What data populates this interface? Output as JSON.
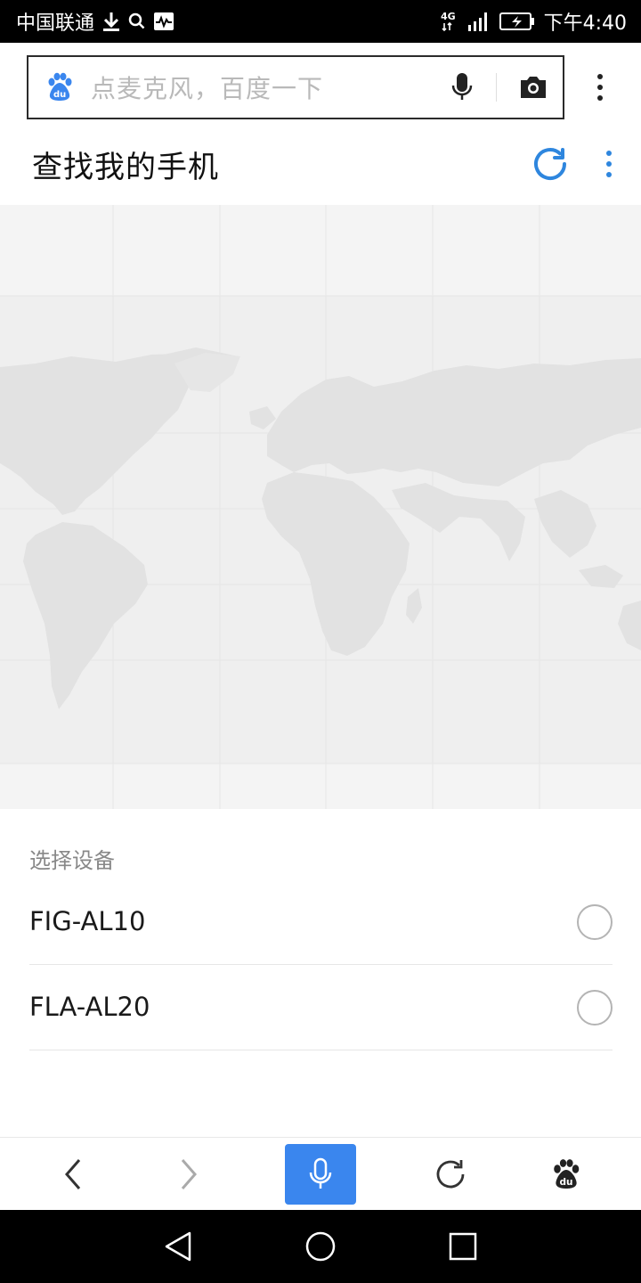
{
  "status_bar": {
    "carrier": "中国联通",
    "network": "4G",
    "time": "下午4:40"
  },
  "search": {
    "placeholder": "点麦克风，百度一下"
  },
  "header": {
    "title": "查找我的手机"
  },
  "devices": {
    "section_label": "选择设备",
    "items": [
      {
        "name": "FIG-AL10",
        "selected": false
      },
      {
        "name": "FLA-AL20",
        "selected": false
      }
    ]
  },
  "colors": {
    "accent": "#3a86ee",
    "refresh": "#2e86de",
    "map_land": "#e4e4e4",
    "map_water": "#f4f4f4"
  },
  "icons": {
    "toolbar": [
      "back-icon",
      "forward-icon",
      "microphone-icon",
      "refresh-icon",
      "baidu-paw-icon"
    ],
    "navbar": [
      "nav-back-icon",
      "nav-home-icon",
      "nav-recents-icon"
    ]
  }
}
